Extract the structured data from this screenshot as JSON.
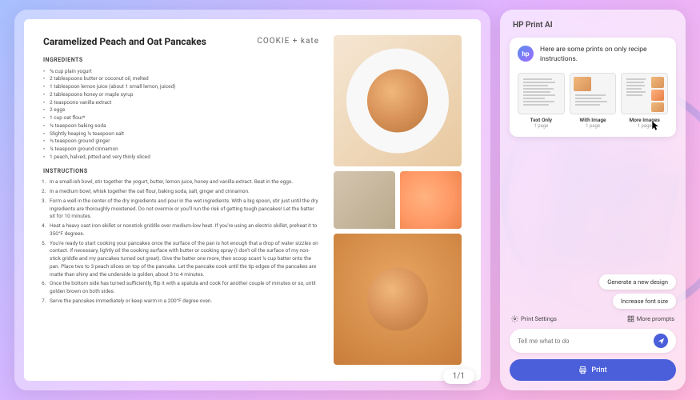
{
  "document": {
    "title": "Caramelized Peach and Oat Pancakes",
    "brand": "COOKIE + kate",
    "section_ingredients": "Ingredients",
    "section_instructions": "Instructions",
    "ingredients": [
      "¾ cup plain yogurt",
      "2 tablespoons butter or coconut oil, melted",
      "1 tablespoon lemon juice (about 1 small lemon, juiced)",
      "2 tablespoons honey or maple syrup",
      "2 teaspoons vanilla extract",
      "2 eggs",
      "1 cup oat flour*",
      "½ teaspoon baking soda",
      "Slightly heaping ¼ teaspoon salt",
      "½ teaspoon ground ginger",
      "¼ teaspoon ground cinnamon",
      "1 peach, halved, pitted and very thinly sliced"
    ],
    "instructions": [
      "In a small-ish bowl, stir together the yogurt, butter, lemon juice, honey and vanilla extract. Beat in the eggs.",
      "In a medium bowl, whisk together the oat flour, baking soda, salt, ginger and cinnamon.",
      "Form a well in the center of the dry ingredients and pour in the wet ingredients. With a big spoon, stir just until the dry ingredients are thoroughly moistened. Do not overmix or you'll run the risk of getting tough pancakes! Let the batter sit for 10 minutes.",
      "Heat a heavy cast iron skillet or nonstick griddle over medium-low heat. If you're using an electric skillet, preheat it to 350°F degrees.",
      "You're ready to start cooking your pancakes once the surface of the pan is hot enough that a drop of water sizzles on contact. If necessary, lightly oil the cooking surface with butter or cooking spray (I don't oil the surface of my non-stick griddle and my pancakes turned out great). Give the batter one more, then scoop scant ¼ cup batter onto the pan. Place two to 3 peach slices on top of the pancake. Let the pancake cook until the tip edges of the pancakes are matte than shiny and the underside is golden, about 3 to 4 minutes.",
      "Once the bottom side has turned sufficiently, flip it with a spatula and cook for another couple of minutes or so, until golden brown on both sides.",
      "Serve the pancakes immediately or keep warm in a 200°F degree oven."
    ],
    "page_indicator": "1/1"
  },
  "ai_panel": {
    "title": "HP Print AI",
    "avatar_label": "hp",
    "message": "Here are some prints on only recipe instructions.",
    "options": [
      {
        "label": "Text Only",
        "sub": "1 page"
      },
      {
        "label": "With Image",
        "sub": "1 page"
      },
      {
        "label": "More Images",
        "sub": "1 page"
      }
    ],
    "suggestions": [
      "Generate a new design",
      "Increase font size"
    ],
    "action_settings": "Print Settings",
    "action_more": "More prompts",
    "input_placeholder": "Tell me what to do",
    "print_button": "Print"
  }
}
